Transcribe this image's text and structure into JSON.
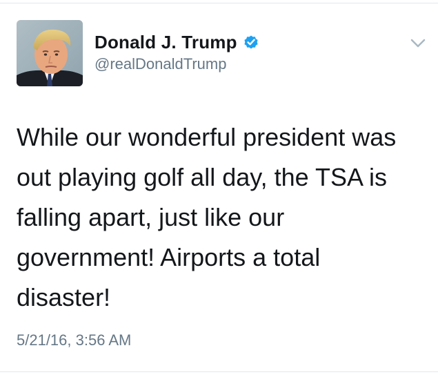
{
  "author": {
    "display_name": "Donald J. Trump",
    "handle": "@realDonaldTrump",
    "verified": true,
    "avatar_icon": "profile-photo"
  },
  "tweet": {
    "text": "While our wonderful president was\nout playing golf all day, the TSA is\nfalling apart, just like our\ngovernment! Airports a total\ndisaster!",
    "timestamp": "5/21/16, 3:56 AM"
  },
  "icons": {
    "verified": "verified-badge-icon",
    "menu": "chevron-down-icon"
  },
  "colors": {
    "verified_badge": "#1da1f2",
    "primary_text": "#14171a",
    "secondary_text": "#657786",
    "divider": "#e1e8ed"
  }
}
